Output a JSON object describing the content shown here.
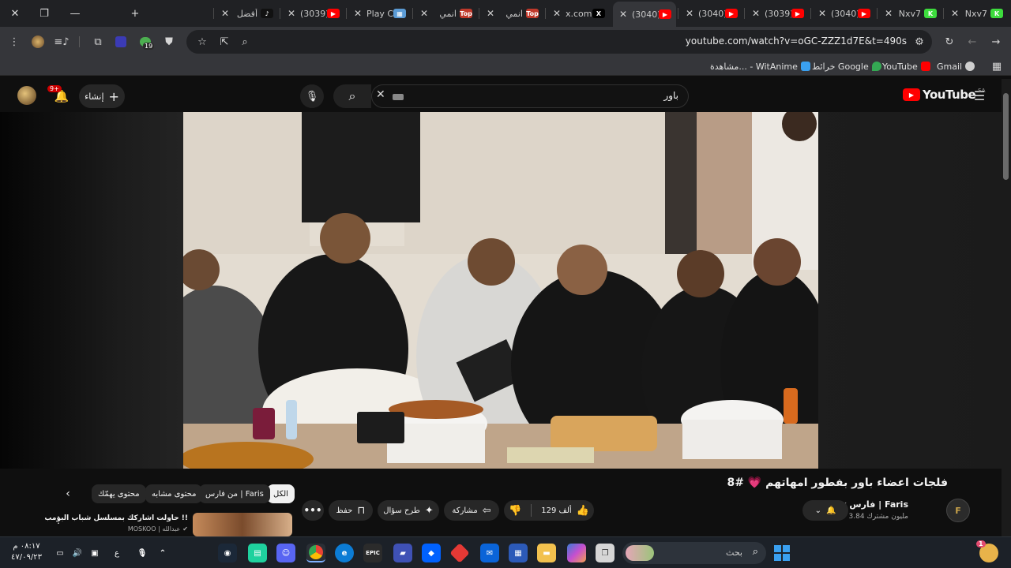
{
  "browser": {
    "tabs": [
      {
        "title": "Nxv7",
        "favicon": "K",
        "color": "#3ddc3d"
      },
      {
        "title": "Nxv7",
        "favicon": "K",
        "color": "#3ddc3d"
      },
      {
        "title": "(3040)",
        "favicon": "▶",
        "color": "#ff0000"
      },
      {
        "title": "(3039)",
        "favicon": "▶",
        "color": "#ff0000"
      },
      {
        "title": "(3040)",
        "favicon": "▶",
        "color": "#ff0000"
      },
      {
        "title": "(3040)",
        "favicon": "▶",
        "color": "#ff0000",
        "active": true
      },
      {
        "title": "x.com",
        "favicon": "X",
        "color": "#000000"
      },
      {
        "title": "انمي",
        "favicon": "Top",
        "color": "#c0392b"
      },
      {
        "title": "انمي",
        "favicon": "Top",
        "color": "#c0392b"
      },
      {
        "title": "Play C",
        "favicon": "▦",
        "color": "#5b9bd5"
      },
      {
        "title": "(3039)",
        "favicon": "▶",
        "color": "#ff0000"
      },
      {
        "title": "أفضل",
        "favicon": "♪",
        "color": "#111111"
      }
    ],
    "url": "youtube.com/watch?v=oGC-ZZZ1d7E&t=490s",
    "bookmarks": [
      {
        "label": "Gmail",
        "color": "#dcdcdc"
      },
      {
        "label": "YouTube",
        "color": "#ff0000"
      },
      {
        "label": "خرائط Google",
        "color": "#34a853"
      },
      {
        "label": "مشاهدة... - WitAnime",
        "color": "#3aa0f0"
      }
    ],
    "extension_badge": "19"
  },
  "youtube": {
    "logo_text": "YouTube",
    "region": "SA",
    "search_value": "باور",
    "create_label": "إنشاء",
    "notification_count": "9+"
  },
  "video": {
    "title": "فلجات اعضاء باور بفطور امهاتهم 💗 #8",
    "channel_name": "فارس | Faris",
    "subscribers": "3.84 مليون مشترك",
    "likes": "129 ألف",
    "share_label": "مشاركة",
    "ask_label": "طرح سؤال",
    "save_label": "حفظ"
  },
  "chips": [
    "الكل",
    "من فارس | Faris",
    "محتوى مشابه",
    "محتوى يهمّك"
  ],
  "recommendation": {
    "title": "حاولت اشاركك بمسلسل شباب البومب !!",
    "channel": "MOSKOO | عبدالله"
  },
  "taskbar": {
    "search_placeholder": "بحث",
    "time": "٠٨:١٧ م",
    "date": "٤٧/٠٩/٢٣",
    "lang": "ع",
    "chat_badge": "1"
  }
}
